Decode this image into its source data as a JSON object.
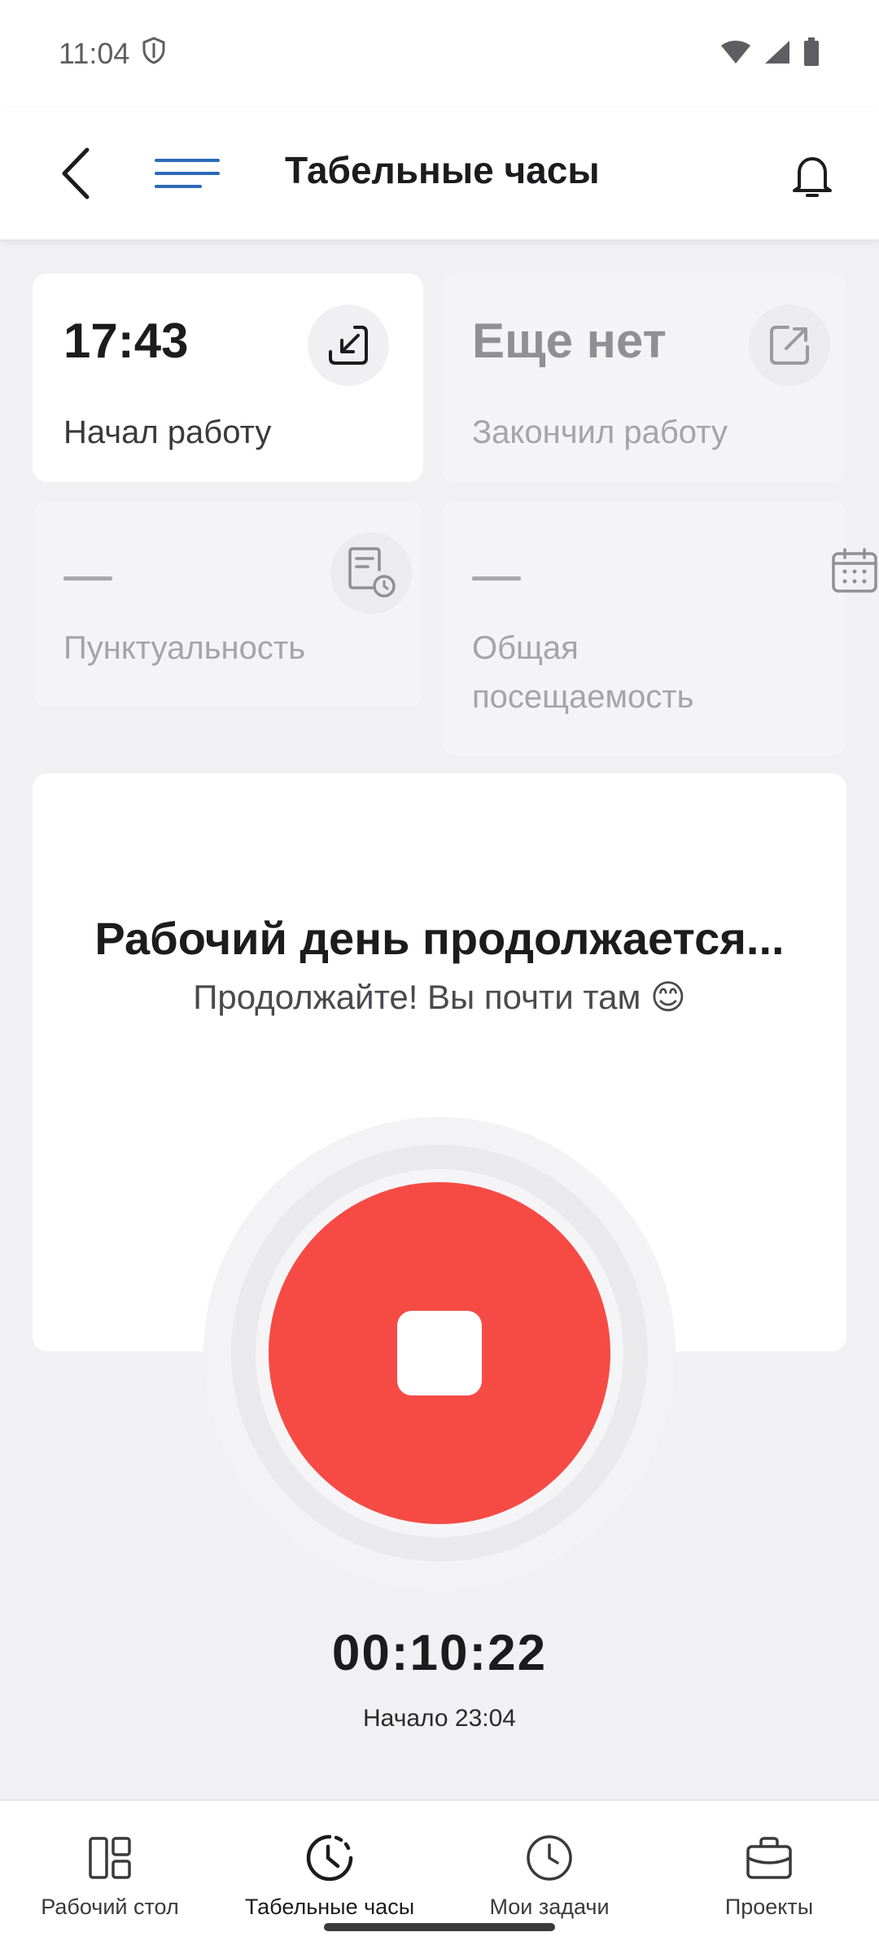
{
  "status_bar": {
    "time": "11:04"
  },
  "app_bar": {
    "title": "Табельные часы"
  },
  "cards": {
    "start": {
      "value": "17:43",
      "label": "Начал работу"
    },
    "end": {
      "value": "Еще нет",
      "label": "Закончил работу"
    },
    "punctuality": {
      "label": "Пунктуальность"
    },
    "attendance": {
      "label_line1": "Общая",
      "label_line2": "посещаемость"
    }
  },
  "main": {
    "title": "Рабочий день продолжается...",
    "subtitle": "Продолжайте! Вы почти там 😊",
    "timer": "00:10:22",
    "start_label": "Начало 23:04"
  },
  "bottom_nav": {
    "items": [
      {
        "label": "Рабочий стол",
        "icon": "dashboard-icon",
        "active": false
      },
      {
        "label": "Табельные часы",
        "icon": "clock-timer-icon",
        "active": true
      },
      {
        "label": "Мои задачи",
        "icon": "clock-icon",
        "active": false
      },
      {
        "label": "Проекты",
        "icon": "briefcase-icon",
        "active": false
      }
    ]
  },
  "colors": {
    "accent_blue": "#2d6ab7",
    "stop_red": "#f64b44"
  }
}
